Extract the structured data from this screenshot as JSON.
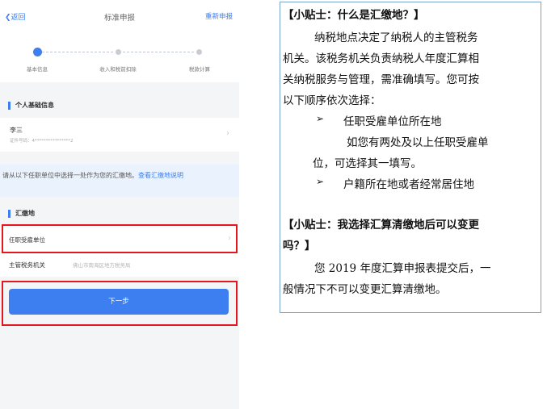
{
  "phone": {
    "nav": {
      "back_label": "返回",
      "title": "标准申报",
      "redo_label": "重新申报"
    },
    "steps": [
      {
        "label": "基本信息",
        "state": "active"
      },
      {
        "label": "收入和税前扣除",
        "state": "idle"
      },
      {
        "label": "税款计算",
        "state": "idle"
      }
    ],
    "personal_section": {
      "title": "个人基础信息",
      "name": "李三",
      "id_text": "证件号码：4****************2"
    },
    "notice": {
      "text": "请从以下任职单位中选择一处作为您的汇缴地。",
      "link": "查看汇缴地说明"
    },
    "remit_section": {
      "title": "汇缴地",
      "employer_label": "任职受雇单位",
      "tax_authority_label": "主管税务机关",
      "tax_authority_value": "佛山市南海区地方税务局"
    },
    "next_button": "下一步",
    "accent_color": "#3d7ef0",
    "highlight_color": "#e5171c"
  },
  "tips": {
    "tip1_title": "【小贴士：什么是汇缴地？】",
    "tip1_lines": [
      "纳税地点决定了纳税人的主管税务",
      "机关。该税务机关负责纳税人年度汇算相",
      "关纳税服务与管理，需准确填写。您可按",
      "以下顺序依次选择："
    ],
    "option1": "任职受雇单位所在地",
    "option1_note_lines": [
      "如您有两处及以上任职受雇单",
      "位，可选择其一填写。"
    ],
    "option2": "户籍所在地或者经常居住地",
    "tip2_title_lines": [
      "【小贴士：我选择汇算清缴地后可以变更",
      "吗？】"
    ],
    "tip2_lines": [
      "您 2019 年度汇算申报表提交后，一",
      "般情况下不可以变更汇算清缴地。"
    ],
    "border_color": "#7aa2cf"
  }
}
